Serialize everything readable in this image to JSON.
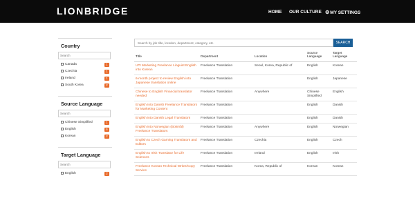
{
  "header": {
    "logo": "LIONBRIDGE",
    "nav": [
      "HOME",
      "OUR CULTURE",
      "MY SETTINGS"
    ]
  },
  "sidebar": {
    "country": {
      "title": "Country",
      "placeholder": "Search",
      "options": [
        {
          "label": "Canada",
          "count": "1"
        },
        {
          "label": "Czechia",
          "count": "1"
        },
        {
          "label": "Ireland",
          "count": "1"
        },
        {
          "label": "South Korea",
          "count": "2"
        }
      ]
    },
    "source_language": {
      "title": "Source Language",
      "placeholder": "Search",
      "options": [
        {
          "label": "Chinese Simplified",
          "count": "1"
        },
        {
          "label": "English",
          "count": "6"
        },
        {
          "label": "Korean",
          "count": "2"
        }
      ]
    },
    "target_language": {
      "title": "Target Language",
      "placeholder": "Search",
      "options": [
        {
          "label": "English",
          "count": "2"
        }
      ]
    }
  },
  "search": {
    "placeholder": "Search by job title, location, department, category, etc.",
    "button": "SEARCH"
  },
  "table": {
    "headers": [
      "Title",
      "Department",
      "Location",
      "Source Language",
      "Target Language"
    ],
    "rows": [
      {
        "title": "UTI Marketing Freelance Linguist English into Korean",
        "department": "Freelance Translation",
        "location": "Seoul, Korea, Republic of",
        "source": "English",
        "target": "Korean"
      },
      {
        "title": "6-month project to review English into Japanese translation online",
        "department": "Freelance Translation",
        "location": "",
        "source": "English",
        "target": "Japanese"
      },
      {
        "title": "Chinese to English Financial translator needed",
        "department": "Freelance Translation",
        "location": "Anywhere",
        "source": "Chinese Simplified",
        "target": "English"
      },
      {
        "title": "English Into Danish Freelance Translators for Marketing Content",
        "department": "Freelance Translation",
        "location": "",
        "source": "English",
        "target": "Danish"
      },
      {
        "title": "English into Danish Legal Translators",
        "department": "Freelance Translation",
        "location": "",
        "source": "English",
        "target": "Danish"
      },
      {
        "title": "English into Norwegian (Bokmål) Freelance Translators",
        "department": "Freelance Translation",
        "location": "Anywhere",
        "source": "English",
        "target": "Norwegian"
      },
      {
        "title": "English to Czech Gaming Translators and Editors",
        "department": "Freelance Translation",
        "location": "Czechia",
        "source": "English",
        "target": "Czech"
      },
      {
        "title": "English to Irish Translator for Life Sciences",
        "department": "Freelance Translation",
        "location": "Ireland",
        "source": "English",
        "target": "Irish"
      },
      {
        "title": "Freelance Korean Technical Writer/Copy Service",
        "department": "Freelance Translation",
        "location": "Korea, Republic of",
        "source": "Korean",
        "target": "Korean"
      }
    ]
  }
}
